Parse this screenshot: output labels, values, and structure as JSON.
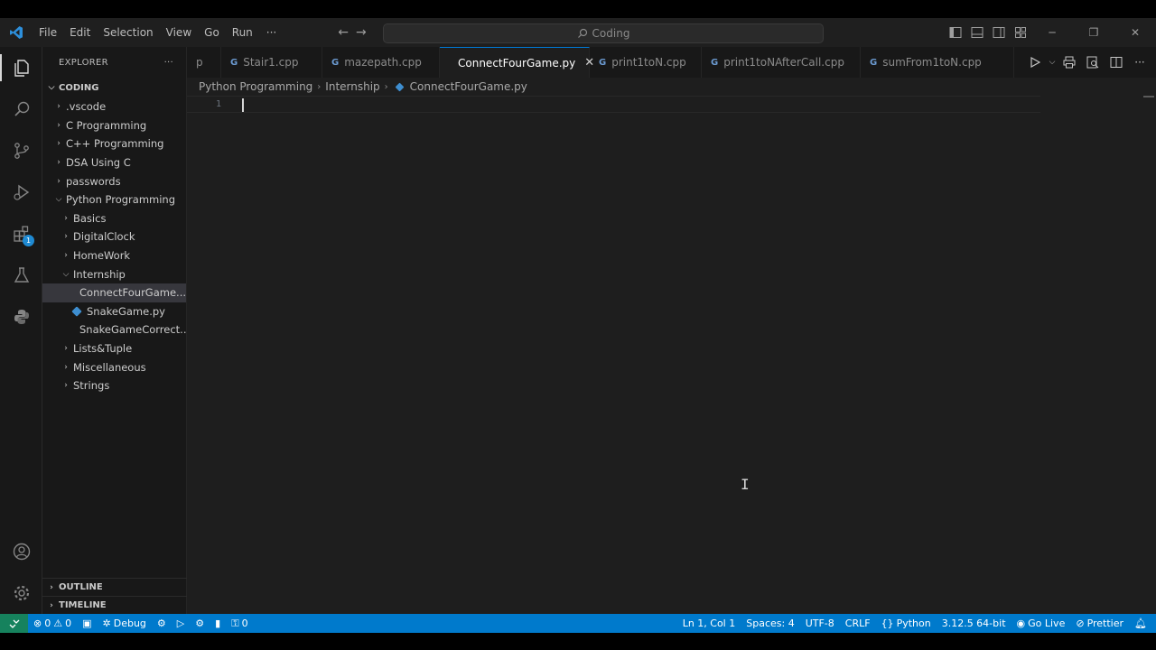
{
  "titlebar": {
    "menu": [
      "File",
      "Edit",
      "Selection",
      "View",
      "Go",
      "Run"
    ],
    "more": "···",
    "search_text": "Coding"
  },
  "activity": {
    "extensions_badge": "1"
  },
  "explorer": {
    "header": "EXPLORER",
    "more": "···",
    "root": "CODING",
    "items": [
      {
        "label": ".vscode",
        "type": "folder",
        "open": false,
        "depth": 1
      },
      {
        "label": "C Programming",
        "type": "folder",
        "open": false,
        "depth": 1
      },
      {
        "label": "C++ Programming",
        "type": "folder",
        "open": false,
        "depth": 1
      },
      {
        "label": "DSA Using C",
        "type": "folder",
        "open": false,
        "depth": 1
      },
      {
        "label": "passwords",
        "type": "folder",
        "open": false,
        "depth": 1
      },
      {
        "label": "Python Programming",
        "type": "folder",
        "open": true,
        "depth": 1
      },
      {
        "label": "Basics",
        "type": "folder",
        "open": false,
        "depth": 2
      },
      {
        "label": "DigitalClock",
        "type": "folder",
        "open": false,
        "depth": 2
      },
      {
        "label": "HomeWork",
        "type": "folder",
        "open": false,
        "depth": 2
      },
      {
        "label": "Internship",
        "type": "folder",
        "open": true,
        "depth": 2
      },
      {
        "label": "ConnectFourGame....",
        "type": "python",
        "depth": 3,
        "selected": true
      },
      {
        "label": "SnakeGame.py",
        "type": "python",
        "depth": 3
      },
      {
        "label": "SnakeGameCorrect...",
        "type": "python",
        "depth": 3
      },
      {
        "label": "Lists&Tuple",
        "type": "folder",
        "open": false,
        "depth": 2
      },
      {
        "label": "Miscellaneous",
        "type": "folder",
        "open": false,
        "depth": 2
      },
      {
        "label": "Strings",
        "type": "folder",
        "open": false,
        "depth": 2
      }
    ],
    "outline": "OUTLINE",
    "timeline": "TIMELINE"
  },
  "tabs": [
    {
      "label": "p",
      "icon": "none"
    },
    {
      "label": "Stair1.cpp",
      "icon": "cpp"
    },
    {
      "label": "mazepath.cpp",
      "icon": "cpp"
    },
    {
      "label": "ConnectFourGame.py",
      "icon": "python",
      "active": true
    },
    {
      "label": "print1toN.cpp",
      "icon": "cpp"
    },
    {
      "label": "print1toNAfterCall.cpp",
      "icon": "cpp"
    },
    {
      "label": "sumFrom1toN.cpp",
      "icon": "cpp"
    }
  ],
  "tab_close": "✕",
  "breadcrumb": {
    "parts": [
      "Python Programming",
      "Internship"
    ],
    "file": "ConnectFourGame.py"
  },
  "editor": {
    "line_number": "1",
    "ibeam": "I"
  },
  "statusbar": {
    "errors": "0",
    "warnings": "0",
    "debug": "Debug",
    "ports": "0",
    "position": "Ln 1, Col 1",
    "spaces": "Spaces: 4",
    "encoding": "UTF-8",
    "eol": "CRLF",
    "language": "Python",
    "interpreter": "3.12.5 64-bit",
    "golive": "Go Live",
    "prettier": "Prettier"
  },
  "colors": {
    "accent": "#007acc",
    "remote": "#16825d",
    "python_icon": "#3e8ed0"
  }
}
